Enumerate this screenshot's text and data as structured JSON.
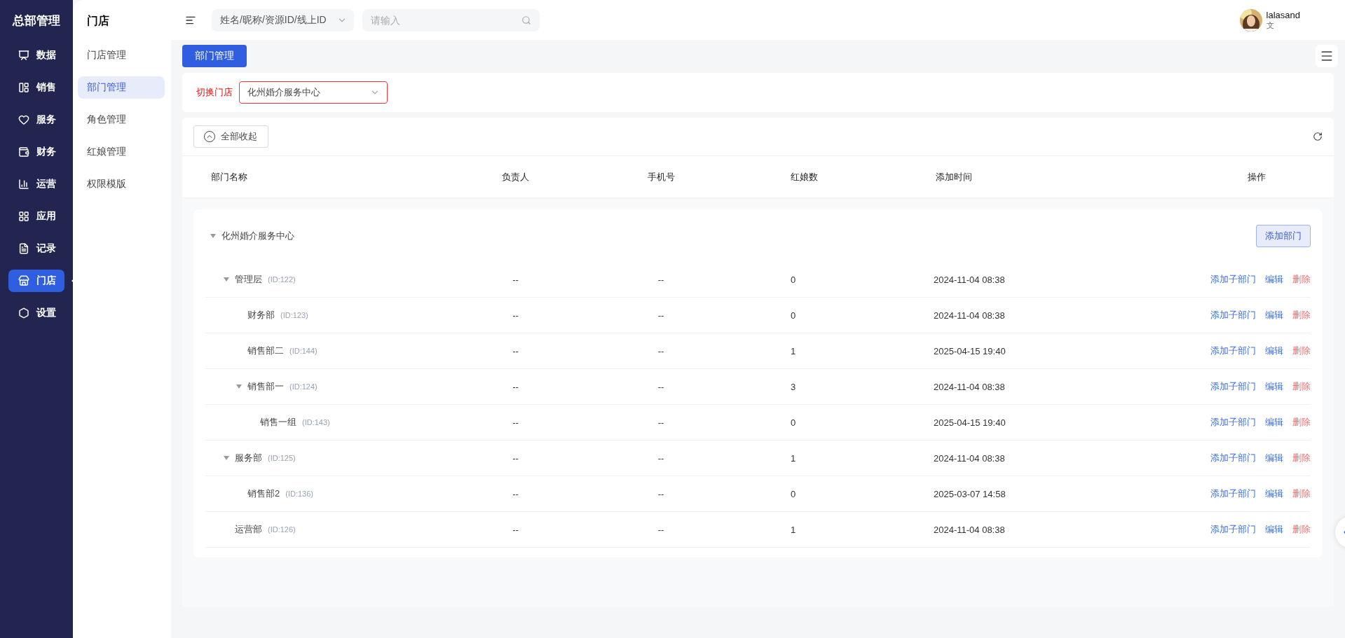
{
  "app_title": "总部管理",
  "nav": [
    {
      "label": "数据",
      "selected": false
    },
    {
      "label": "销售",
      "selected": false
    },
    {
      "label": "服务",
      "selected": false
    },
    {
      "label": "财务",
      "selected": false
    },
    {
      "label": "运营",
      "selected": false
    },
    {
      "label": "应用",
      "selected": false
    },
    {
      "label": "记录",
      "selected": false
    },
    {
      "label": "门店",
      "selected": true
    },
    {
      "label": "设置",
      "selected": false
    }
  ],
  "submenu": {
    "title": "门店",
    "items": [
      {
        "label": "门店管理",
        "selected": false
      },
      {
        "label": "部门管理",
        "selected": true
      },
      {
        "label": "角色管理",
        "selected": false
      },
      {
        "label": "红娘管理",
        "selected": false
      },
      {
        "label": "权限模版",
        "selected": false
      }
    ]
  },
  "topbar": {
    "search_type": "姓名/昵称/资源ID/线上ID",
    "search": {
      "placeholder": "请输入"
    },
    "user": {
      "name": "lalasand",
      "sub": "文"
    }
  },
  "tabs": [
    {
      "label": "部门管理",
      "selected": true
    }
  ],
  "filter": {
    "label": "切换门店",
    "value": "化州婚介服务中心",
    "invalid": true
  },
  "toolbar": {
    "collapse_all": "全部收起"
  },
  "table": {
    "columns": [
      "部门名称",
      "负责人",
      "手机号",
      "红娘数",
      "添加时间",
      "操作"
    ],
    "tree": {
      "name": "化州婚介服务中心",
      "expanded": true,
      "button": "添加部门",
      "children": [
        {
          "name": "管理层",
          "id": "(ID:122)",
          "leader": "--",
          "phone": "--",
          "count": "0",
          "time": "2024-11-04 08:38",
          "expanded": true,
          "actions": [
            {
              "label": "添加子部门",
              "kind": "link"
            },
            {
              "label": "编辑",
              "kind": "link"
            },
            {
              "label": "删除",
              "kind": "danger"
            }
          ],
          "children": [
            {
              "name": "财务部",
              "id": "(ID:123)",
              "leader": "--",
              "phone": "--",
              "count": "0",
              "time": "2024-11-04 08:38",
              "actions": [
                {
                  "label": "添加子部门",
                  "kind": "link"
                },
                {
                  "label": "编辑",
                  "kind": "link"
                },
                {
                  "label": "删除",
                  "kind": "danger"
                }
              ]
            },
            {
              "name": "销售部二",
              "id": "(ID:144)",
              "leader": "--",
              "phone": "--",
              "count": "1",
              "time": "2025-04-15 19:40",
              "actions": [
                {
                  "label": "添加子部门",
                  "kind": "link"
                },
                {
                  "label": "编辑",
                  "kind": "link"
                },
                {
                  "label": "删除",
                  "kind": "danger"
                }
              ]
            },
            {
              "name": "销售部一",
              "id": "(ID:124)",
              "leader": "--",
              "phone": "--",
              "count": "3",
              "time": "2024-11-04 08:38",
              "expanded": true,
              "actions": [
                {
                  "label": "添加子部门",
                  "kind": "link"
                },
                {
                  "label": "编辑",
                  "kind": "link"
                },
                {
                  "label": "删除",
                  "kind": "danger"
                }
              ],
              "children": [
                {
                  "name": "销售一组",
                  "id": "(ID:143)",
                  "leader": "--",
                  "phone": "--",
                  "count": "0",
                  "time": "2025-04-15 19:40",
                  "actions": [
                    {
                      "label": "添加子部门",
                      "kind": "link"
                    },
                    {
                      "label": "编辑",
                      "kind": "link"
                    },
                    {
                      "label": "删除",
                      "kind": "danger"
                    }
                  ]
                }
              ]
            }
          ]
        },
        {
          "name": "服务部",
          "id": "(ID:125)",
          "leader": "--",
          "phone": "--",
          "count": "1",
          "time": "2024-11-04 08:38",
          "expanded": true,
          "actions": [
            {
              "label": "添加子部门",
              "kind": "link"
            },
            {
              "label": "编辑",
              "kind": "link"
            },
            {
              "label": "删除",
              "kind": "danger"
            }
          ],
          "children": [
            {
              "name": "销售部2",
              "id": "(ID:136)",
              "leader": "--",
              "phone": "--",
              "count": "0",
              "time": "2025-03-07 14:58",
              "actions": [
                {
                  "label": "添加子部门",
                  "kind": "link"
                },
                {
                  "label": "编辑",
                  "kind": "link"
                },
                {
                  "label": "删除",
                  "kind": "danger"
                }
              ]
            }
          ]
        },
        {
          "name": "运营部",
          "id": "(ID:126)",
          "leader": "--",
          "phone": "--",
          "count": "1",
          "time": "2024-11-04 08:38",
          "actions": [
            {
              "label": "添加子部门",
              "kind": "link"
            },
            {
              "label": "编辑",
              "kind": "link"
            },
            {
              "label": "删除",
              "kind": "danger"
            }
          ]
        }
      ]
    }
  }
}
